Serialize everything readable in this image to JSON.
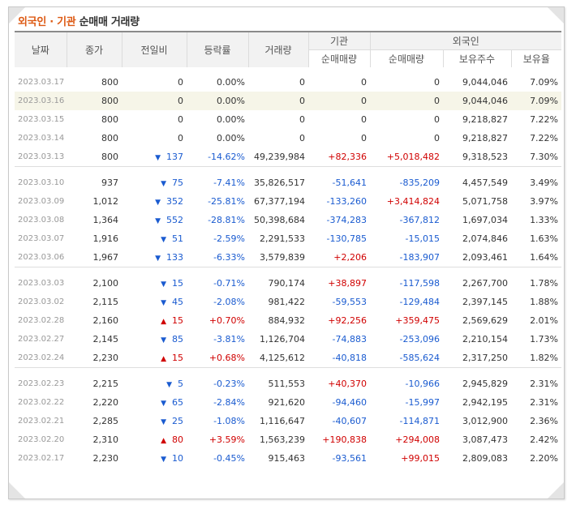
{
  "title": {
    "part1": "외국인",
    "dot": " · ",
    "part2": "기관",
    "rest": " 순매매 거래량"
  },
  "headers": {
    "date": "날짜",
    "close": "종가",
    "change": "전일비",
    "rate": "등락률",
    "volume": "거래량",
    "institution": "기관",
    "foreign": "외국인",
    "inst_net": "순매매량",
    "foreign_net": "순매매량",
    "holdings": "보유주수",
    "ratio": "보유율"
  },
  "groups": [
    [
      {
        "date": "2023.03.17",
        "close": "800",
        "dir": "none",
        "change": "0",
        "rate": "0.00%",
        "volume": "0",
        "inst": "0",
        "foreign": "0",
        "holdings": "9,044,046",
        "ratio": "7.09%"
      },
      {
        "date": "2023.03.16",
        "close": "800",
        "dir": "none",
        "change": "0",
        "rate": "0.00%",
        "volume": "0",
        "inst": "0",
        "foreign": "0",
        "holdings": "9,044,046",
        "ratio": "7.09%",
        "highlight": true
      },
      {
        "date": "2023.03.15",
        "close": "800",
        "dir": "none",
        "change": "0",
        "rate": "0.00%",
        "volume": "0",
        "inst": "0",
        "foreign": "0",
        "holdings": "9,218,827",
        "ratio": "7.22%"
      },
      {
        "date": "2023.03.14",
        "close": "800",
        "dir": "none",
        "change": "0",
        "rate": "0.00%",
        "volume": "0",
        "inst": "0",
        "foreign": "0",
        "holdings": "9,218,827",
        "ratio": "7.22%"
      },
      {
        "date": "2023.03.13",
        "close": "800",
        "dir": "down",
        "change": "137",
        "rate": "-14.62%",
        "volume": "49,239,984",
        "inst": "+82,336",
        "foreign": "+5,018,482",
        "holdings": "9,318,523",
        "ratio": "7.30%"
      }
    ],
    [
      {
        "date": "2023.03.10",
        "close": "937",
        "dir": "down",
        "change": "75",
        "rate": "-7.41%",
        "volume": "35,826,517",
        "inst": "-51,641",
        "foreign": "-835,209",
        "holdings": "4,457,549",
        "ratio": "3.49%"
      },
      {
        "date": "2023.03.09",
        "close": "1,012",
        "dir": "down",
        "change": "352",
        "rate": "-25.81%",
        "volume": "67,377,194",
        "inst": "-133,260",
        "foreign": "+3,414,824",
        "holdings": "5,071,758",
        "ratio": "3.97%"
      },
      {
        "date": "2023.03.08",
        "close": "1,364",
        "dir": "down",
        "change": "552",
        "rate": "-28.81%",
        "volume": "50,398,684",
        "inst": "-374,283",
        "foreign": "-367,812",
        "holdings": "1,697,034",
        "ratio": "1.33%"
      },
      {
        "date": "2023.03.07",
        "close": "1,916",
        "dir": "down",
        "change": "51",
        "rate": "-2.59%",
        "volume": "2,291,533",
        "inst": "-130,785",
        "foreign": "-15,015",
        "holdings": "2,074,846",
        "ratio": "1.63%"
      },
      {
        "date": "2023.03.06",
        "close": "1,967",
        "dir": "down",
        "change": "133",
        "rate": "-6.33%",
        "volume": "3,579,839",
        "inst": "+2,206",
        "foreign": "-183,907",
        "holdings": "2,093,461",
        "ratio": "1.64%"
      }
    ],
    [
      {
        "date": "2023.03.03",
        "close": "2,100",
        "dir": "down",
        "change": "15",
        "rate": "-0.71%",
        "volume": "790,174",
        "inst": "+38,897",
        "foreign": "-117,598",
        "holdings": "2,267,700",
        "ratio": "1.78%"
      },
      {
        "date": "2023.03.02",
        "close": "2,115",
        "dir": "down",
        "change": "45",
        "rate": "-2.08%",
        "volume": "981,422",
        "inst": "-59,553",
        "foreign": "-129,484",
        "holdings": "2,397,145",
        "ratio": "1.88%"
      },
      {
        "date": "2023.02.28",
        "close": "2,160",
        "dir": "up",
        "change": "15",
        "rate": "+0.70%",
        "volume": "884,932",
        "inst": "+92,256",
        "foreign": "+359,475",
        "holdings": "2,569,629",
        "ratio": "2.01%"
      },
      {
        "date": "2023.02.27",
        "close": "2,145",
        "dir": "down",
        "change": "85",
        "rate": "-3.81%",
        "volume": "1,126,704",
        "inst": "-74,883",
        "foreign": "-253,096",
        "holdings": "2,210,154",
        "ratio": "1.73%"
      },
      {
        "date": "2023.02.24",
        "close": "2,230",
        "dir": "up",
        "change": "15",
        "rate": "+0.68%",
        "volume": "4,125,612",
        "inst": "-40,818",
        "foreign": "-585,624",
        "holdings": "2,317,250",
        "ratio": "1.82%"
      }
    ],
    [
      {
        "date": "2023.02.23",
        "close": "2,215",
        "dir": "down",
        "change": "5",
        "rate": "-0.23%",
        "volume": "511,553",
        "inst": "+40,370",
        "foreign": "-10,966",
        "holdings": "2,945,829",
        "ratio": "2.31%"
      },
      {
        "date": "2023.02.22",
        "close": "2,220",
        "dir": "down",
        "change": "65",
        "rate": "-2.84%",
        "volume": "921,620",
        "inst": "-94,460",
        "foreign": "-15,997",
        "holdings": "2,942,195",
        "ratio": "2.31%"
      },
      {
        "date": "2023.02.21",
        "close": "2,285",
        "dir": "down",
        "change": "25",
        "rate": "-1.08%",
        "volume": "1,116,647",
        "inst": "-40,607",
        "foreign": "-114,871",
        "holdings": "3,012,900",
        "ratio": "2.36%"
      },
      {
        "date": "2023.02.20",
        "close": "2,310",
        "dir": "up",
        "change": "80",
        "rate": "+3.59%",
        "volume": "1,563,239",
        "inst": "+190,838",
        "foreign": "+294,008",
        "holdings": "3,087,473",
        "ratio": "2.42%"
      },
      {
        "date": "2023.02.17",
        "close": "2,230",
        "dir": "down",
        "change": "10",
        "rate": "-0.45%",
        "volume": "915,463",
        "inst": "-93,561",
        "foreign": "+99,015",
        "holdings": "2,809,083",
        "ratio": "2.20%"
      }
    ]
  ],
  "colors": {
    "up": "#d00000",
    "down": "#1a5bd0",
    "accent": "#dd5a14"
  }
}
